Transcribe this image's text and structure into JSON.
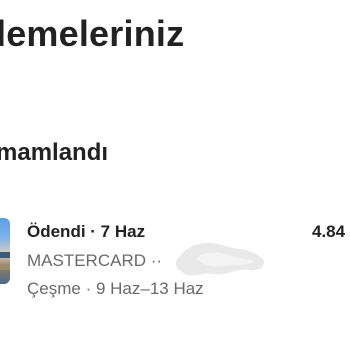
{
  "page": {
    "title": "lemeleriniz"
  },
  "section": {
    "heading": "mamlandı"
  },
  "payment": {
    "status_date": "Ödendi · 7 Haz",
    "amount": "4.84",
    "card": "MASTERCARD ··",
    "location_dates": "Çeşme · 9 Haz–13 Haz"
  }
}
